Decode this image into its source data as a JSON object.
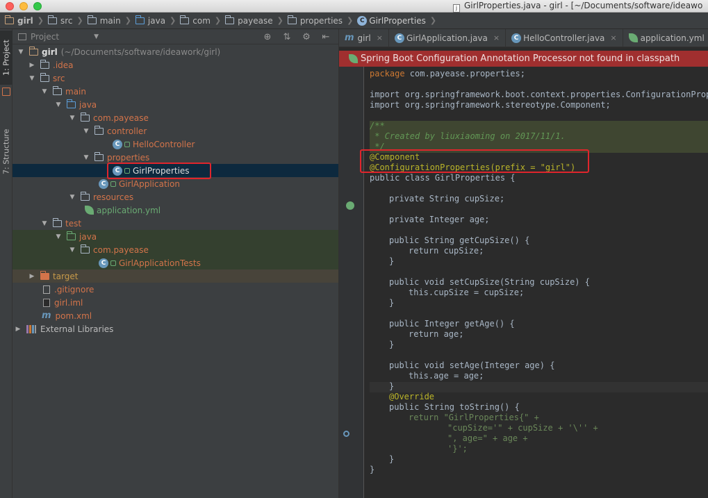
{
  "window": {
    "title": "GirlProperties.java - girl - [~/Documents/software/ideawo"
  },
  "breadcrumb": [
    "girl",
    "src",
    "main",
    "java",
    "com",
    "payease",
    "properties",
    "GirlProperties"
  ],
  "toolstrip": {
    "project_tab": "1: Project",
    "structure_tab": "7: Structure"
  },
  "project_panel": {
    "title": "Project",
    "root_name": "girl",
    "root_path": "(~/Documents/software/ideawork/girl)",
    "items": {
      "idea": ".idea",
      "src": "src",
      "main": "main",
      "java": "java",
      "com_payease": "com.payease",
      "controller": "controller",
      "hello_controller": "HelloController",
      "properties": "properties",
      "girl_properties": "GirlProperties",
      "girl_application": "GirlApplication",
      "resources": "resources",
      "application_yml": "application.yml",
      "test": "test",
      "test_java": "java",
      "test_com_payease": "com.payease",
      "girl_application_tests": "GirlApplicationTests",
      "target": "target",
      "gitignore": ".gitignore",
      "girl_iml": "girl.iml",
      "pom_xml": "pom.xml",
      "external_libraries": "External Libraries"
    }
  },
  "editor": {
    "tabs": [
      "girl",
      "GirlApplication.java",
      "HelloController.java",
      "application.yml"
    ],
    "banner": "Spring Boot Configuration Annotation Processor not found in classpath",
    "code_lines": [
      "package com.payease.properties;",
      "import org.springframework.boot.context.properties.ConfigurationProper",
      "import org.springframework.stereotype.Component;",
      "/**",
      " * Created by liuxiaoming on 2017/11/1.",
      " */",
      "@Component",
      "@ConfigurationProperties(prefix = \"girl\")",
      "public class GirlProperties {",
      "private String cupSize;",
      "private Integer age;",
      "public String getCupSize() {",
      "return cupSize;",
      "}",
      "public void setCupSize(String cupSize) {",
      "this.cupSize = cupSize;",
      "public Integer getAge() {",
      "return age;",
      "public void setAge(Integer age) {",
      "this.age = age;",
      "@Override",
      "public String toString() {",
      "return \"GirlProperties{\" +",
      "\"cupSize='\" + cupSize + '\\'' +",
      "\", age=\" + age +",
      "'}';",
      "}"
    ]
  },
  "colors": {
    "highlight_box": "#e0252c",
    "banner_bg": "#a02f2f",
    "selection_bg": "#0d293e"
  }
}
